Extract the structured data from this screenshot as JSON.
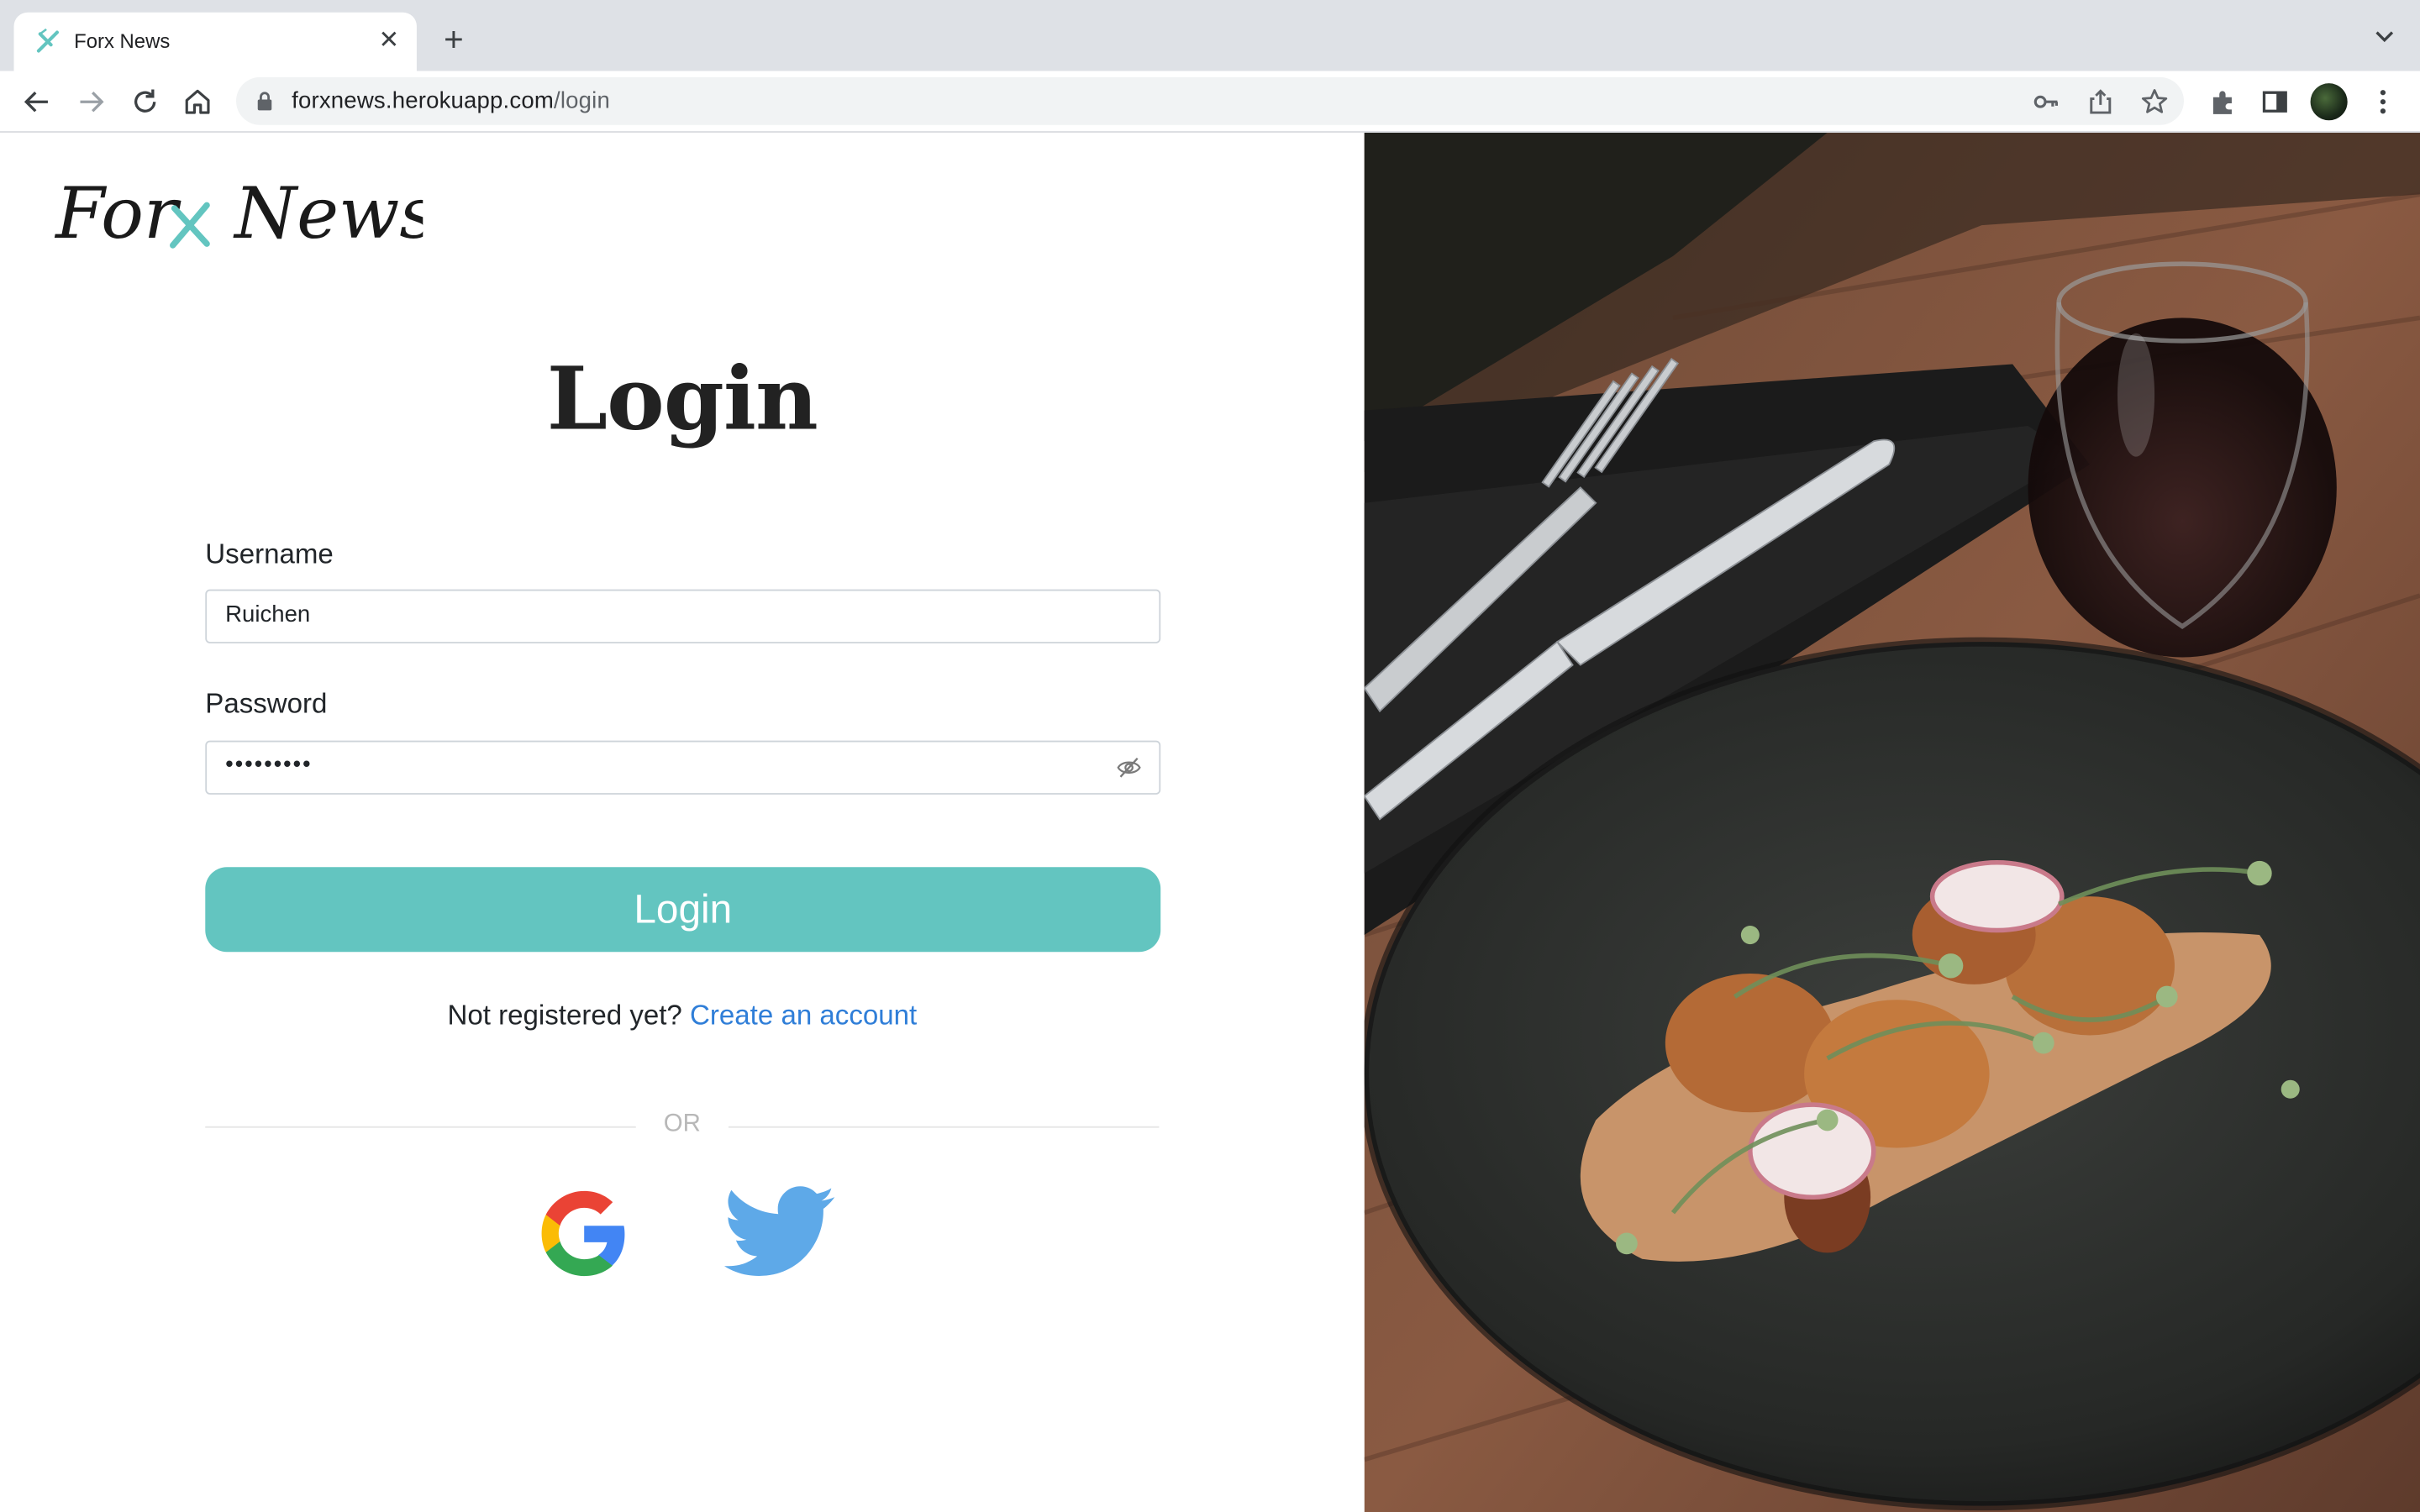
{
  "browser": {
    "tab_title": "Forx News",
    "url_host": "forxnews.herokuapp.com",
    "url_path": "/login"
  },
  "icons": {
    "back": "back-arrow-icon",
    "forward": "forward-arrow-icon",
    "reload": "reload-icon",
    "home": "home-icon",
    "lock": "lock-icon",
    "key": "key-icon",
    "share": "share-icon",
    "bookmark": "star-icon",
    "extensions": "puzzle-icon",
    "side_panel": "side-panel-icon",
    "menu": "kebab-menu-icon",
    "password_toggle": "eye-slash-icon",
    "google": "google-icon",
    "twitter": "twitter-icon"
  },
  "brand": {
    "logo_text_left": "For",
    "logo_text_right": "News",
    "accent": "#63c5c0",
    "link_color": "#2f7ed8"
  },
  "login": {
    "heading": "Login",
    "username_label": "Username",
    "username_value": "Ruichen",
    "password_label": "Password",
    "password_value": "•••••••••",
    "button_label": "Login",
    "register_prompt": "Not registered yet?",
    "register_link": "Create an account",
    "divider_text": "OR"
  },
  "hero": {
    "description_icon": "food-photo"
  }
}
